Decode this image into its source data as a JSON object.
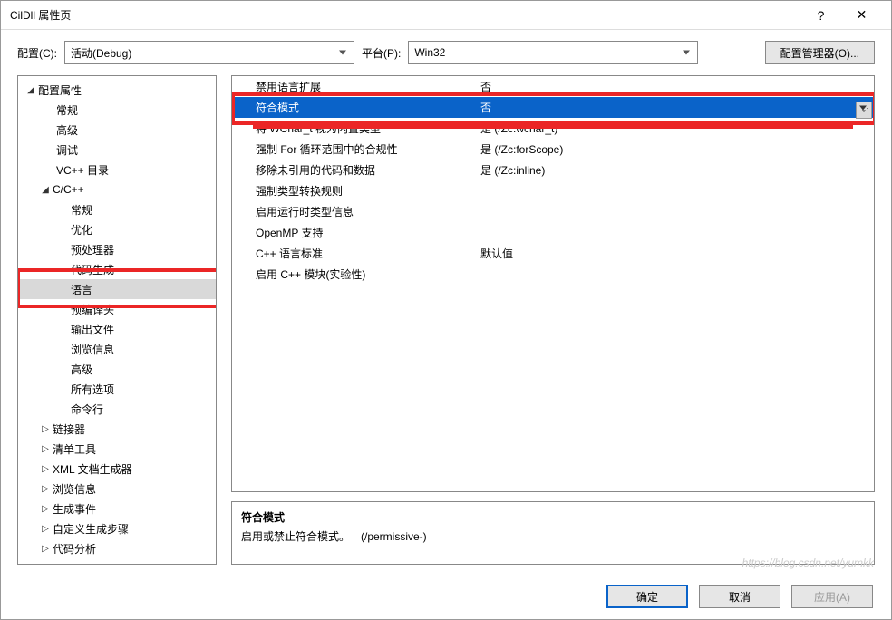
{
  "window": {
    "title": "CilDll 属性页"
  },
  "top": {
    "config_label": "配置(C):",
    "config_value": "活动(Debug)",
    "platform_label": "平台(P):",
    "platform_value": "Win32",
    "manager_button": "配置管理器(O)..."
  },
  "tree": {
    "root": "配置属性",
    "items_l1": [
      "常规",
      "高级",
      "调试",
      "VC++ 目录"
    ],
    "cpp": "C/C++",
    "items_cpp": [
      "常规",
      "优化",
      "预处理器",
      "代码生成",
      "语言",
      "预编译头",
      "输出文件",
      "浏览信息",
      "高级",
      "所有选项",
      "命令行"
    ],
    "items_l1b": [
      "链接器",
      "清单工具",
      "XML 文档生成器",
      "浏览信息",
      "生成事件",
      "自定义生成步骤",
      "代码分析"
    ]
  },
  "grid": {
    "rows": [
      {
        "k": "禁用语言扩展",
        "v": "否"
      },
      {
        "k": "符合模式",
        "v": "否"
      },
      {
        "k": "将 WChar_t 视为内置类型",
        "v": "是 (/Zc:wchar_t)"
      },
      {
        "k": "强制 For 循环范围中的合规性",
        "v": "是 (/Zc:forScope)"
      },
      {
        "k": "移除未引用的代码和数据",
        "v": "是 (/Zc:inline)"
      },
      {
        "k": "强制类型转换规则",
        "v": ""
      },
      {
        "k": "启用运行时类型信息",
        "v": ""
      },
      {
        "k": "OpenMP 支持",
        "v": ""
      },
      {
        "k": "C++ 语言标准",
        "v": "默认值"
      },
      {
        "k": "启用 C++ 模块(实验性)",
        "v": ""
      }
    ]
  },
  "desc": {
    "title": "符合模式",
    "body": "启用或禁止符合模式。 (/permissive-)"
  },
  "footer": {
    "ok": "确定",
    "cancel": "取消",
    "apply": "应用(A)"
  },
  "watermark": "https://blog.csdn.net/yumkk"
}
